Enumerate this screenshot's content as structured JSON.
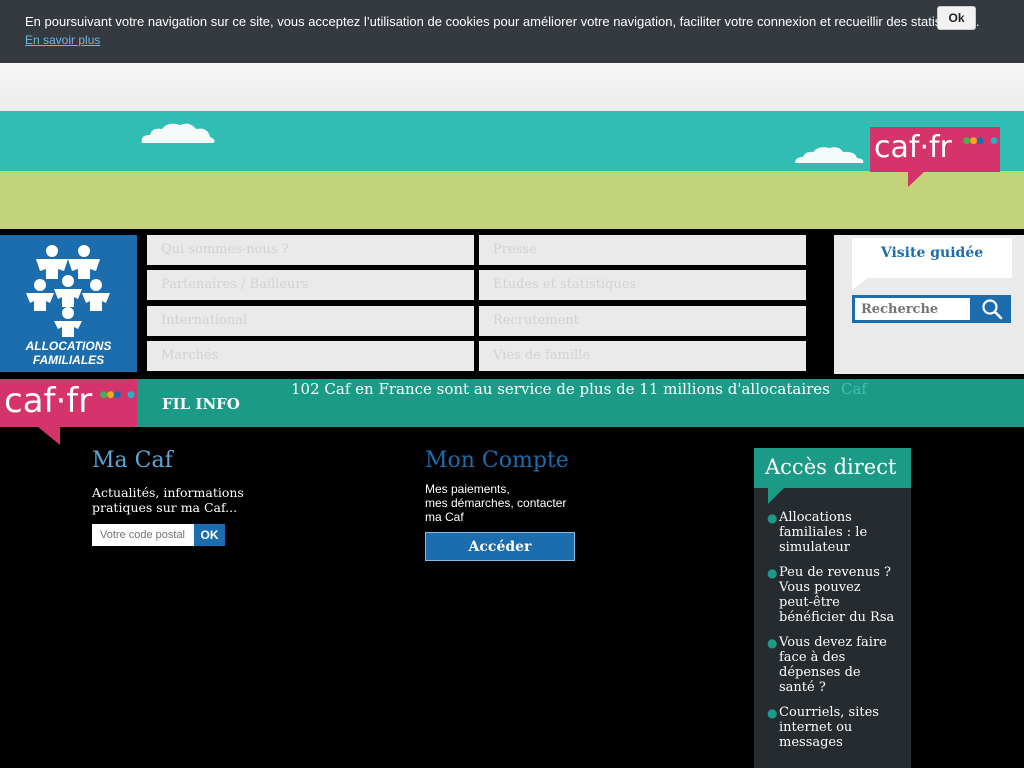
{
  "cookie": {
    "text": "En poursuivant votre navigation sur ce site, vous acceptez l’utilisation de cookies pour améliorer votre navigation, faciliter votre connexion et recueillir des statistiques.",
    "more_link": "En savoir plus",
    "ok_label": "Ok"
  },
  "brand": {
    "badge_text": "caf·fr",
    "logo_line1": "ALLOCATIONS",
    "logo_line2": "FAMILIALES"
  },
  "nav": {
    "items": [
      "Qui sommes-nous ?",
      "Presse",
      "Partenaires / Bailleurs",
      "Etudes et statistiques",
      "International",
      "Recrutement",
      "Marchés",
      "Vies de famille"
    ]
  },
  "side": {
    "visite_label": "Visite guidée",
    "search_placeholder": "Recherche"
  },
  "filinfo": {
    "label": "FIL INFO",
    "text": "102 Caf en France sont au service de plus de 11 millions d'allocataires",
    "ghost": "Caf"
  },
  "macaf": {
    "title": "Ma Caf",
    "description": "Actualités, informations pratiques sur ma Caf...",
    "postal_placeholder": "Votre code postal",
    "ok_label": "OK"
  },
  "compte": {
    "title": "Mon Compte",
    "line1": "Mes paiements,",
    "line2": "mes démarches, contacter",
    "line3": "ma Caf",
    "button": "Accéder"
  },
  "acces": {
    "title": "Accès direct",
    "items": [
      "Allocations familiales : le simulateur",
      "Peu de revenus ? Vous pouvez peut-être bénéficier du Rsa",
      "Vous devez faire face à des dépenses de santé ?",
      "Courriels, sites internet ou messages"
    ]
  },
  "colors": {
    "brand_pink": "#d4336b",
    "brand_blue": "#1c6dad",
    "teal": "#1b9a88",
    "sky": "#2fbdb4",
    "grass": "#c3d37a"
  }
}
